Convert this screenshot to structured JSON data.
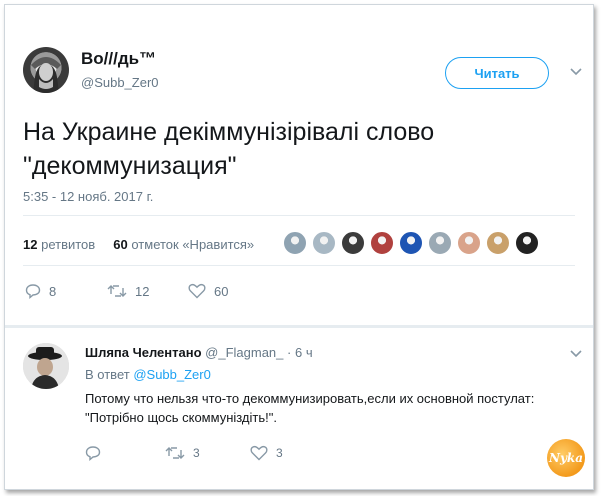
{
  "tweet": {
    "author_name": "Во///дь™",
    "author_handle": "@Subb_Zer0",
    "follow_label": "Читать",
    "text": "На Украине декіммунізірівалі слово \"декоммунизация\"",
    "timestamp": "5:35 - 12 нояб. 2017 г.",
    "retweets_count": "12",
    "retweets_label": "ретвитов",
    "likes_count": "60",
    "likes_label": "отметок «Нравится»",
    "likers": [
      "#8fa3b2",
      "#a8b8c4",
      "#3b3b3b",
      "#b0413e",
      "#1e55b3",
      "#9aa9b4",
      "#d9a38a",
      "#c9a06a",
      "#222222"
    ],
    "actions": {
      "reply_count": "8",
      "retweet_count": "12",
      "like_count": "60"
    }
  },
  "reply": {
    "author_name": "Шляпа Челентано",
    "author_handle": "@_Flagman_",
    "dot": "·",
    "time": "6 ч",
    "in_reply_label": "В ответ",
    "in_reply_handle": "@Subb_Zer0",
    "text": "Потому что нельзя что-то декоммунизировать,если их основной постулат: \"Потрібно щось скоммуніздіть!\".",
    "actions": {
      "reply_count": "",
      "retweet_count": "3",
      "like_count": "3"
    }
  },
  "watermark_text": "Nyka",
  "colors": {
    "accent": "#1da1f2",
    "muted": "#657786",
    "divider": "#e6ecf0"
  }
}
